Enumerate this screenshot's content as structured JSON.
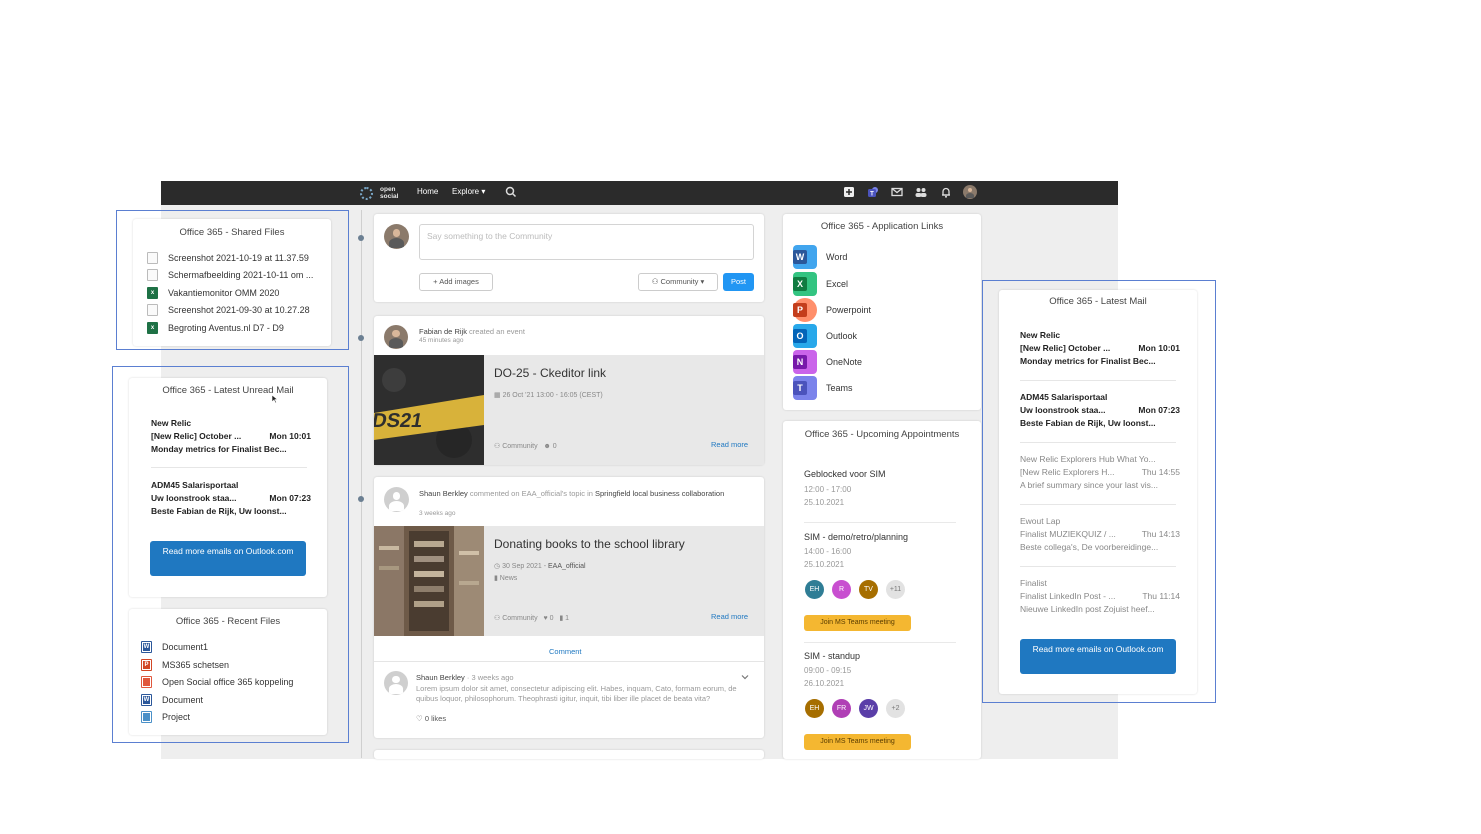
{
  "topbar": {
    "brand": "open social",
    "home": "Home",
    "explore": "Explore",
    "explore_caret": "▾",
    "icons": [
      "add-icon",
      "teams-icon",
      "mail-icon",
      "group-icon",
      "bell-icon",
      "user-avatar"
    ]
  },
  "shared_files": {
    "title": "Office 365 - Shared Files",
    "items": [
      {
        "name": "Screenshot 2021-10-19 at 11.37.59",
        "type": "image"
      },
      {
        "name": "Schermafbeelding 2021-10-11 om ...",
        "type": "image"
      },
      {
        "name": "Vakantiemonitor OMM 2020",
        "type": "excel"
      },
      {
        "name": "Screenshot 2021-09-30 at 10.27.28",
        "type": "image"
      },
      {
        "name": "Begroting Aventus.nl D7 - D9",
        "type": "excel"
      }
    ]
  },
  "unread_mail": {
    "title": "Office 365 - Latest Unread Mail",
    "items": [
      {
        "from": "New Relic",
        "subject": "[New Relic] October ...",
        "time": "Mon 10:01",
        "preview": "Monday metrics for Finalist Bec..."
      },
      {
        "from": "ADM45 Salarisportaal",
        "subject": "Uw loonstrook staa...",
        "time": "Mon 07:23",
        "preview": "Beste Fabian de Rijk, Uw loonst..."
      }
    ],
    "button": "Read more emails on Outlook.com"
  },
  "recent_files": {
    "title": "Office 365 - Recent Files",
    "items": [
      {
        "name": "Document1",
        "type": "word"
      },
      {
        "name": "MS365 schetsen",
        "type": "ppt"
      },
      {
        "name": "Open Social office 365 koppeling",
        "type": "pdf"
      },
      {
        "name": "Document",
        "type": "word"
      },
      {
        "name": "Project",
        "type": "proj"
      }
    ]
  },
  "composer": {
    "placeholder": "Say something to the Community",
    "add_images": "+ Add images",
    "visibility": "Community",
    "post": "Post"
  },
  "post1": {
    "author": "Fabian de Rijk",
    "action": "created an event",
    "time": "45 minutes ago",
    "event_title": "DO-25 - Ckeditor link",
    "date": "26 Oct '21 13:00 - 16:05 (CEST)",
    "visibility": "Community",
    "count": "0",
    "read_more": "Read more"
  },
  "post2": {
    "author": "Shaun Berkley",
    "action": "commented on EAA_official's topic in",
    "group": "Springfield local business collaboration",
    "time": "3 weeks ago",
    "title": "Donating books to the school library",
    "date": "30 Sep 2021",
    "date_author": "EAA_official",
    "tag": "News",
    "visibility": "Community",
    "likes_count": "0",
    "comments_count": "1",
    "read_more": "Read more",
    "comment_link": "Comment",
    "comment": {
      "author": "Shaun Berkley",
      "time": "3 weeks ago",
      "text": "Lorem ipsum dolor sit amet, consectetur adipiscing elit. Habes, inquam, Cato, formam eorum, de quibus loquor, philosophorum. Theophrasti igitur, inquit, tibi liber ille placet de beata vita?",
      "likes": "0 likes"
    }
  },
  "app_links": {
    "title": "Office 365 - Application Links",
    "items": [
      {
        "name": "Word",
        "letter": "W",
        "color": "#2b579a",
        "bg": "#41a5ee"
      },
      {
        "name": "Excel",
        "letter": "X",
        "color": "#107c41",
        "bg": "#33c481"
      },
      {
        "name": "Powerpoint",
        "letter": "P",
        "color": "#c43e1c",
        "bg": "#ff8f6b"
      },
      {
        "name": "Outlook",
        "letter": "O",
        "color": "#0364b8",
        "bg": "#28a8ea"
      },
      {
        "name": "OneNote",
        "letter": "N",
        "color": "#7719aa",
        "bg": "#ca64ea"
      },
      {
        "name": "Teams",
        "letter": "T",
        "color": "#4b53bc",
        "bg": "#7b83eb"
      }
    ]
  },
  "appointments": {
    "title": "Office 365 - Upcoming Appointments",
    "items": [
      {
        "title": "Geblocked voor SIM",
        "time": "12:00 - 17:00",
        "date": "25.10.2021"
      },
      {
        "title": "SIM - demo/retro/planning",
        "time": "14:00 - 16:00",
        "date": "25.10.2021",
        "attendees": [
          {
            "initials": "EH",
            "color": "#2f7d95"
          },
          {
            "initials": "R",
            "color": "#c84fd0"
          },
          {
            "initials": "TV",
            "color": "#a66e00"
          }
        ],
        "more": "+11",
        "teams": "Join MS Teams meeting"
      },
      {
        "title": "SIM - standup",
        "time": "09:00 - 09:15",
        "date": "26.10.2021",
        "attendees": [
          {
            "initials": "EH",
            "color": "#a66e00"
          },
          {
            "initials": "FR",
            "color": "#b03fb5"
          },
          {
            "initials": "JW",
            "color": "#5a3ea8"
          }
        ],
        "more": "+2",
        "teams": "Join MS Teams meeting"
      }
    ]
  },
  "latest_mail": {
    "title": "Office 365 - Latest Mail",
    "items": [
      {
        "from": "New Relic",
        "subject": "[New Relic] October ...",
        "time": "Mon 10:01",
        "preview": "Monday metrics for Finalist Bec...",
        "unread": true
      },
      {
        "from": "ADM45 Salarisportaal",
        "subject": "Uw loonstrook staa...",
        "time": "Mon 07:23",
        "preview": "Beste Fabian de Rijk, Uw loonst...",
        "unread": true
      },
      {
        "from": "New Relic Explorers Hub What Yo...",
        "subject": "[New Relic Explorers H...",
        "time": "Thu 14:55",
        "preview": "A brief summary since your last vis...",
        "unread": false
      },
      {
        "from": "Ewout Lap",
        "subject": "Finalist MUZIEKQUIZ / ...",
        "time": "Thu 14:13",
        "preview": "Beste collega's, De voorbereidinge...",
        "unread": false
      },
      {
        "from": "Finalist",
        "subject": "Finalist LinkedIn Post - ...",
        "time": "Thu 11:14",
        "preview": "Nieuwe LinkedIn post Zojuist heef...",
        "unread": false
      }
    ],
    "button": "Read more emails on Outlook.com"
  }
}
